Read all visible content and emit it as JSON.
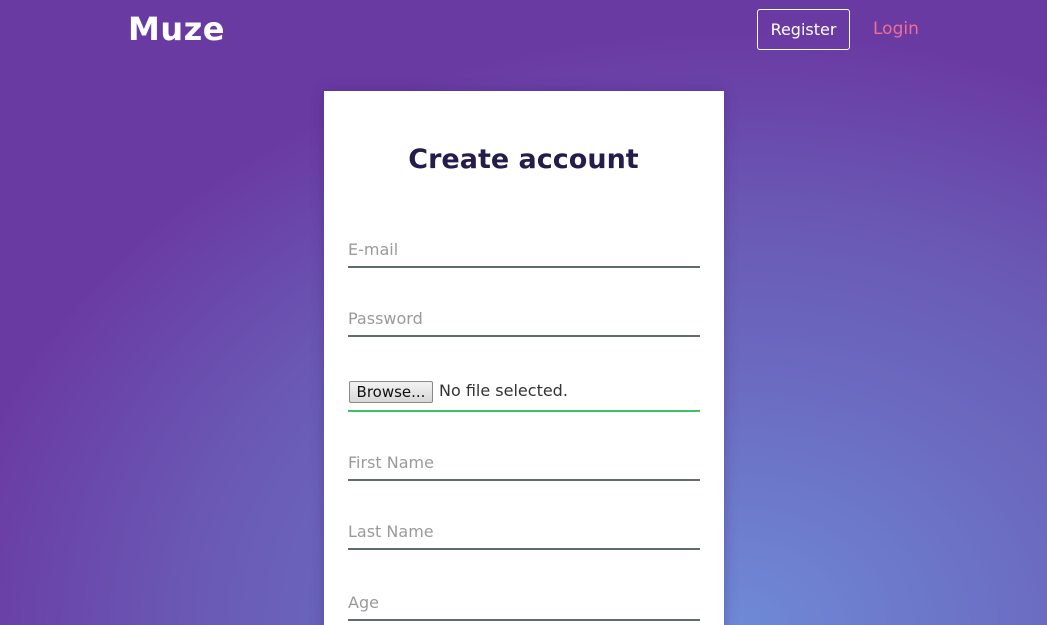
{
  "header": {
    "brand": "Muze",
    "register_label": "Register",
    "login_label": "Login"
  },
  "form": {
    "title": "Create account",
    "email_placeholder": "E-mail",
    "password_placeholder": "Password",
    "file_button_label": "Browse...",
    "file_status": "No file selected.",
    "first_name_placeholder": "First Name",
    "last_name_placeholder": "Last Name",
    "age_placeholder": "Age"
  },
  "colors": {
    "background_gradient": [
      "#6a3aa3",
      "#6a5ab5",
      "#6f8ad6"
    ],
    "login_link": "#f26d92",
    "title_text": "#221d4a",
    "file_field_underline": "#3cc06a",
    "field_underline": "#5f6b6d"
  }
}
